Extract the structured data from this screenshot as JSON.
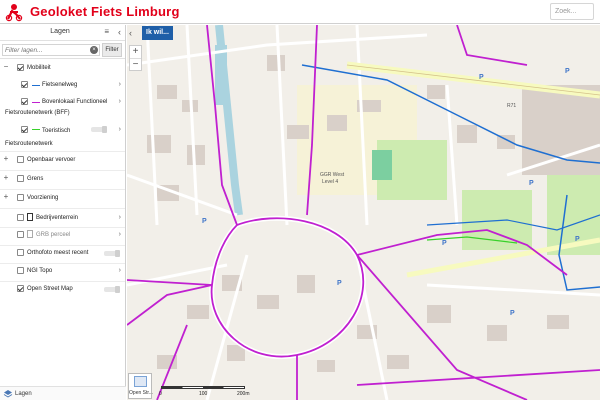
{
  "header": {
    "title": "Geoloket Fiets Limburg",
    "search_placeholder": "Zoek..."
  },
  "sidebar": {
    "title": "Lagen",
    "filter_placeholder": "Filter lagen...",
    "filter_button": "Filter",
    "footer_label": "Lagen",
    "layers": {
      "mobiliteit": "Mobiliteit",
      "fietsenelweg": "Fietsenelweg",
      "bovenlokaal": "Bovenlokaal Functioneel",
      "bff": "Fietsroutenetwerk (BFF)",
      "toeristisch": "Toeristisch",
      "frn": "Fietsroutenetwerk",
      "openbaar_vervoer": "Openbaar vervoer",
      "grens": "Grens",
      "voorziening": "Voorziening",
      "bedrijventerrein": "Bedrijventerrein",
      "grb": "GRB perceel",
      "orthofoto": "Orthofoto meest recent",
      "ngi": "NGI Topo",
      "osm": "Open Street Map"
    }
  },
  "map": {
    "ik_wil": "Ik wil...",
    "bg_label": "Open Str...",
    "scale": [
      "0",
      "100",
      "200m"
    ],
    "labels": {
      "ggr_west": "GGR West",
      "level": "Level 4",
      "r71": "R71"
    }
  },
  "colors": {
    "brand_red": "#e2001a",
    "fietsenelweg": "#1f6fd1",
    "bovenlokaal": "#c020d0",
    "toeristisch": "#38d12a",
    "ik_wil_bg": "#1f5fa8"
  }
}
